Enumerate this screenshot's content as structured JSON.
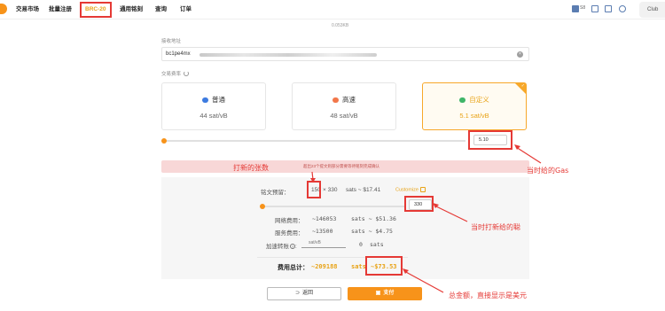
{
  "nav": {
    "items": [
      {
        "label": "交易市场"
      },
      {
        "label": "批量注册"
      },
      {
        "label": "BRC-20"
      },
      {
        "label": "通用铭刻"
      },
      {
        "label": "查询"
      },
      {
        "label": "订单"
      }
    ],
    "active_index": 2,
    "lang_short": "S8",
    "club_label": "Club"
  },
  "inscription_size": "0.053KB",
  "address": {
    "label": "接收地址",
    "value": "bc1pe4mx"
  },
  "fee": {
    "label": "交易费率",
    "cards": [
      {
        "name": "普通",
        "rate": "44 sat/vB",
        "icon": "ship-icon"
      },
      {
        "name": "高速",
        "rate": "48 sat/vB",
        "icon": "plane-icon"
      },
      {
        "name": "自定义",
        "rate": "5.1 sat/vB",
        "icon": "rocket-icon"
      }
    ],
    "selected_index": 2,
    "custom_value": "5.10"
  },
  "warning_text": "超出23个提文则部分需要等待铭刻完成确认",
  "estimate": {
    "label": "铭文预留：",
    "count": "150",
    "mult": "× 330",
    "result": "sats ~ $17.41",
    "customize": "Customize",
    "sats_value": "330"
  },
  "costs": {
    "network_label": "网络费用：",
    "network_value": "~146053",
    "network_usd": "sats ~ $51.36",
    "service_label": "服务费用：",
    "service_value": "~13500",
    "service_usd": "sats ~ $4.75",
    "accel_label": "加速转账",
    "accel_placeholder": "sat/vB",
    "accel_value": "0",
    "accel_unit": "sats",
    "total_label": "费用总计：",
    "total_value": "~209188",
    "total_sats": "sats",
    "total_usd": "~$73.53"
  },
  "buttons": {
    "back": "返回",
    "pay": "支付"
  },
  "annotations": {
    "count_note": "打新的张数",
    "gas_note": "当时给的Gas",
    "sats_note": "当时打新给的聪",
    "total_note": "总金额，直接显示是美元"
  },
  "colors": {
    "accent": "#f7931a",
    "annotation": "#e53935",
    "warning_bg": "#f8d7d7"
  }
}
